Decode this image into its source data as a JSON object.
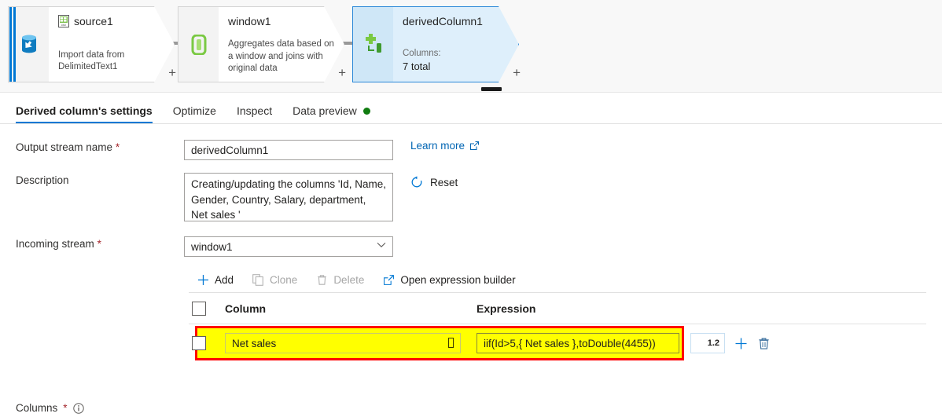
{
  "canvas": {
    "nodes": [
      {
        "id": "source1",
        "title": "source1",
        "subtitle": "Import data from DelimitedText1",
        "plus": "+",
        "icon": "csv-file-icon",
        "type_icon": "database-source-icon",
        "selected": false
      },
      {
        "id": "window1",
        "title": "window1",
        "subtitle": "Aggregates data based on a window and joins with original data",
        "plus": "+",
        "type_icon": "window-transform-icon",
        "selected": false
      },
      {
        "id": "derivedColumn1",
        "title": "derivedColumn1",
        "columns_label": "Columns:",
        "columns_value": "7 total",
        "plus": "+",
        "type_icon": "derived-column-icon",
        "selected": true
      }
    ]
  },
  "tabs": [
    {
      "label": "Derived column's settings",
      "active": true,
      "dot": false
    },
    {
      "label": "Optimize",
      "active": false,
      "dot": false
    },
    {
      "label": "Inspect",
      "active": false,
      "dot": false
    },
    {
      "label": "Data preview",
      "active": false,
      "dot": true
    }
  ],
  "form": {
    "output_stream_label": "Output stream name",
    "output_stream_value": "derivedColumn1",
    "description_label": "Description",
    "description_value": "Creating/updating the columns 'Id, Name, Gender, Country, Salary, department,  Net sales '",
    "incoming_stream_label": "Incoming stream",
    "incoming_stream_value": "window1",
    "columns_label": "Columns",
    "required_mark": "*",
    "learn_more": "Learn more",
    "reset": "Reset"
  },
  "commands": [
    {
      "label": "Add",
      "icon": "plus-icon",
      "disabled": false
    },
    {
      "label": "Clone",
      "icon": "copy-icon",
      "disabled": true
    },
    {
      "label": "Delete",
      "icon": "trash-icon",
      "disabled": true
    },
    {
      "label": "Open expression builder",
      "icon": "external-link-icon",
      "disabled": false
    }
  ],
  "table": {
    "headers": {
      "column": "Column",
      "expression": "Expression"
    },
    "rows": [
      {
        "column": "Net sales",
        "expression": "iif(Id>5,{ Net sales },toDouble(4455))",
        "data_type": "1.2"
      }
    ]
  },
  "colors": {
    "accent": "#0078d4",
    "highlight_fill": "#ffff00",
    "highlight_border": "#ff0000",
    "status_green": "#107c10",
    "required_red": "#a4262c"
  }
}
